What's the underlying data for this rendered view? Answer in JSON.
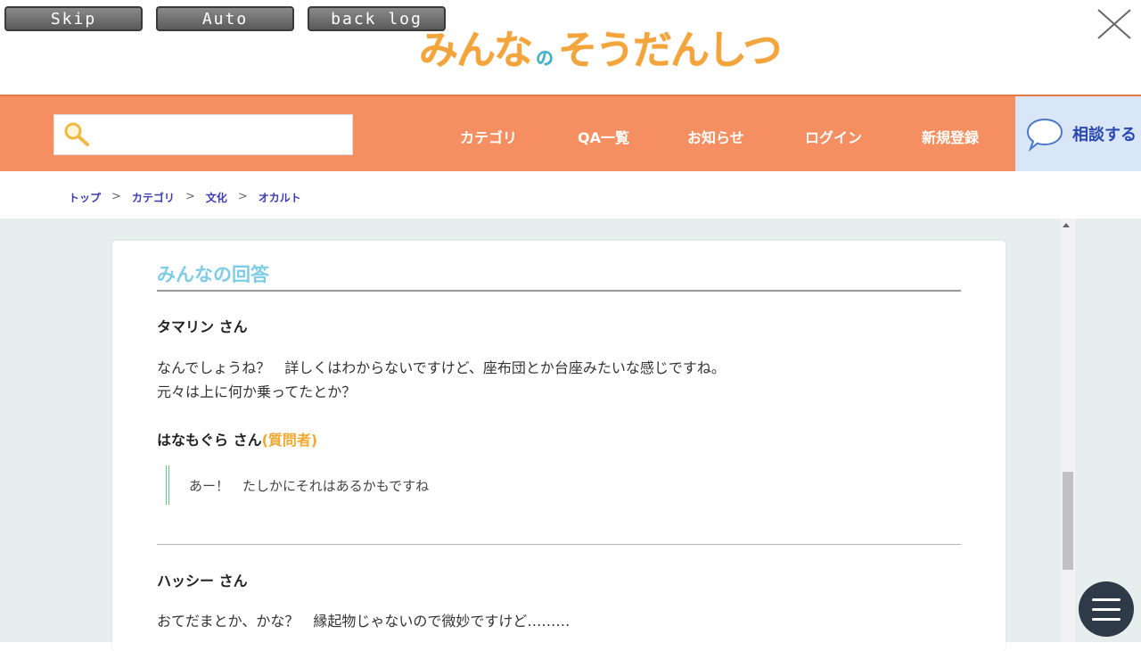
{
  "controls": {
    "skip_label": "Skip",
    "auto_label": "Auto",
    "backlog_label": "back log"
  },
  "logo": {
    "part1": "みんな",
    "part2": "の",
    "part3": "そうだんしつ"
  },
  "nav": {
    "search_placeholder": "",
    "items": [
      "カテゴリ",
      "QA一覧",
      "お知らせ",
      "ログイン",
      "新規登録"
    ],
    "consult_label": "相談する"
  },
  "breadcrumb": [
    "トップ",
    "カテゴリ",
    "文化",
    "オカルト"
  ],
  "breadcrumb_separator": ">",
  "answers": {
    "section_title": "みんなの回答",
    "a1_author": "タマリン さん",
    "a1_line1": "なんでしょうね？　詳しくはわからないですけど、座布団とか台座みたいな感じですね。",
    "a1_line2": "元々は上に何か乗ってたとか？",
    "reply_author": "はなもぐら さん",
    "reply_role": "(質問者)",
    "reply_text": "あー！　たしかにそれはあるかもですね",
    "a2_author": "ハッシー さん",
    "a2_line1": "おてだまとか、かな？　縁起物じゃないので微妙ですけど………"
  },
  "colors": {
    "nav_bg": "#f58f62",
    "logo": "#f3a53c",
    "section_title": "#7ecde6",
    "quote_border": "#62c98c",
    "role": "#f0a830"
  },
  "icons": [
    "search-icon",
    "close-icon",
    "speech-bubble-icon",
    "hamburger-menu-icon"
  ]
}
